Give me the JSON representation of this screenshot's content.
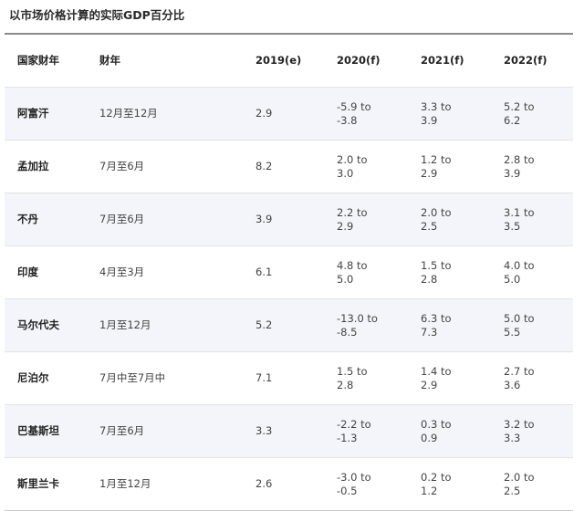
{
  "title": "以市场价格计算的实际GDP百分比",
  "headers": [
    "国家财年",
    "财年",
    "2019(e)",
    "2020(f)",
    "2021(f)",
    "2022(f)"
  ],
  "rows": [
    {
      "country": "阿富汗",
      "fiscal_year": "12月至12月",
      "y2019": "2.9",
      "y2020": "-5.9 to -3.8",
      "y2021": "3.3 to 3.9",
      "y2022": "5.2 to 6.2"
    },
    {
      "country": "孟加拉",
      "fiscal_year": "7月至6月",
      "y2019": "8.2",
      "y2020": "2.0 to 3.0",
      "y2021": "1.2 to 2.9",
      "y2022": "2.8 to 3.9"
    },
    {
      "country": "不丹",
      "fiscal_year": "7月至6月",
      "y2019": "3.9",
      "y2020": "2.2 to 2.9",
      "y2021": "2.0 to 2.5",
      "y2022": "3.1 to 3.5"
    },
    {
      "country": "印度",
      "fiscal_year": "4月至3月",
      "y2019": "6.1",
      "y2020": "4.8 to 5.0",
      "y2021": "1.5 to 2.8",
      "y2022": "4.0 to 5.0"
    },
    {
      "country": "马尔代夫",
      "fiscal_year": "1月至12月",
      "y2019": "5.2",
      "y2020": "-13.0 to -8.5",
      "y2021": "6.3 to 7.3",
      "y2022": "5.0 to 5.5"
    },
    {
      "country": "尼泊尔",
      "fiscal_year": "7月中至7月中",
      "y2019": "7.1",
      "y2020": "1.5 to 2.8",
      "y2021": "1.4 to 2.9",
      "y2022": "2.7 to 3.6"
    },
    {
      "country": "巴基斯坦",
      "fiscal_year": "7月至6月",
      "y2019": "3.3",
      "y2020": "-2.2 to -1.3",
      "y2021": "0.3 to 0.9",
      "y2022": "3.2 to 3.3"
    },
    {
      "country": "斯里兰卡",
      "fiscal_year": "1月至12月",
      "y2019": "2.6",
      "y2020": "-3.0 to -0.5",
      "y2021": "0.2 to 1.2",
      "y2022": "2.0 to 2.5"
    }
  ]
}
